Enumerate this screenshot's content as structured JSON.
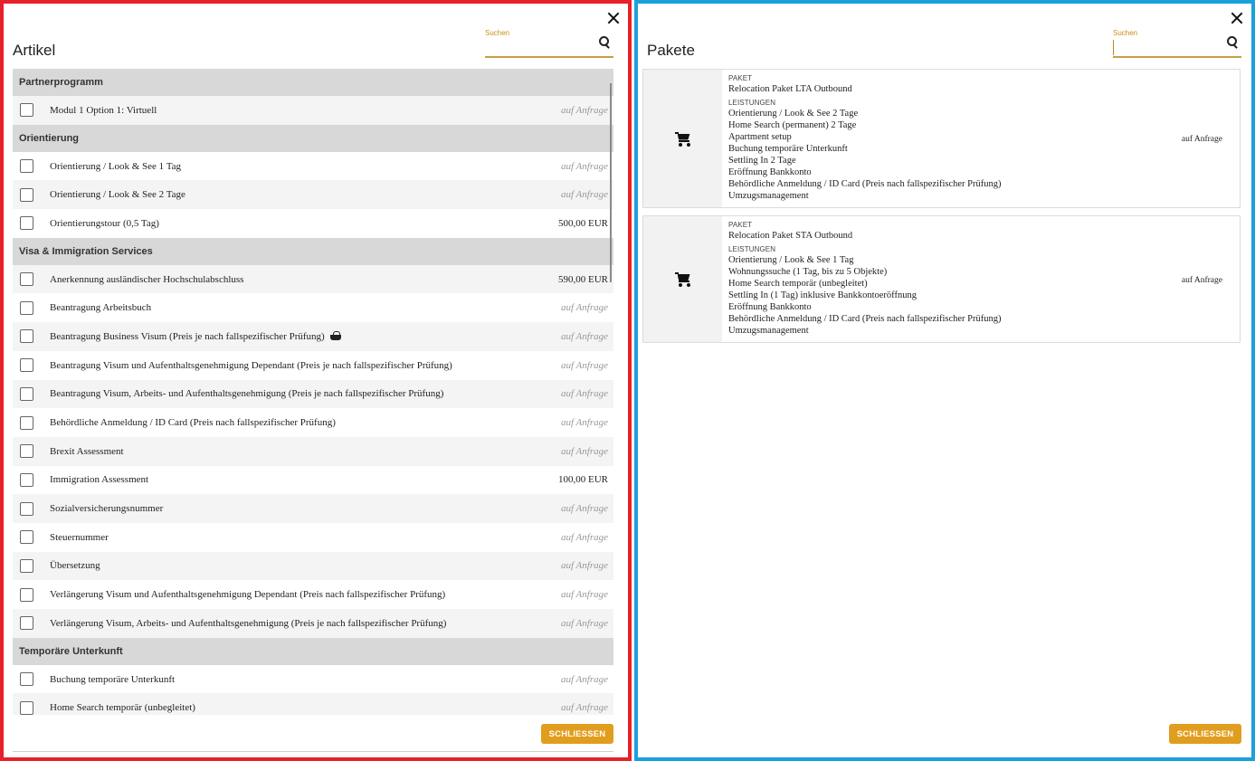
{
  "articles_panel": {
    "title": "Artikel",
    "search": {
      "label": "Suchen",
      "value": ""
    },
    "close_button_label": "SCHLIESSEN",
    "groups": [
      {
        "category": "Partnerprogramm",
        "items": [
          {
            "label": "Modul 1 Option 1: Virtuell",
            "price": "auf Anfrage",
            "basket": false
          }
        ]
      },
      {
        "category": "Orientierung",
        "items": [
          {
            "label": "Orientierung / Look & See 1 Tag",
            "price": "auf Anfrage",
            "basket": false
          },
          {
            "label": "Orientierung / Look & See 2 Tage",
            "price": "auf Anfrage",
            "basket": false
          },
          {
            "label": "Orientierungstour (0,5 Tag)",
            "price": "500,00 EUR",
            "basket": false
          }
        ]
      },
      {
        "category": "Visa & Immigration Services",
        "items": [
          {
            "label": "Anerkennung ausländischer Hochschulabschluss",
            "price": "590,00 EUR",
            "basket": false
          },
          {
            "label": "Beantragung Arbeitsbuch",
            "price": "auf Anfrage",
            "basket": false
          },
          {
            "label": "Beantragung Business Visum (Preis je nach fallspezifischer Prüfung)",
            "price": "auf Anfrage",
            "basket": true
          },
          {
            "label": "Beantragung Visum und Aufenthaltsgenehmigung Dependant (Preis je nach fallspezifischer Prüfung)",
            "price": "auf Anfrage",
            "basket": false
          },
          {
            "label": "Beantragung Visum, Arbeits- und Aufenthaltsgenehmigung (Preis je nach fallspezifischer Prüfung)",
            "price": "auf Anfrage",
            "basket": false
          },
          {
            "label": "Behördliche Anmeldung / ID Card (Preis nach fallspezifischer Prüfung)",
            "price": "auf Anfrage",
            "basket": false
          },
          {
            "label": "Brexit Assessment",
            "price": "auf Anfrage",
            "basket": false
          },
          {
            "label": "Immigration Assessment",
            "price": "100,00 EUR",
            "basket": false
          },
          {
            "label": "Sozialversicherungsnummer",
            "price": "auf Anfrage",
            "basket": false
          },
          {
            "label": "Steuernummer",
            "price": "auf Anfrage",
            "basket": false
          },
          {
            "label": "Übersetzung",
            "price": "auf Anfrage",
            "basket": false
          },
          {
            "label": "Verlängerung Visum und Aufenthaltsgenehmigung Dependant (Preis nach fallspezifischer Prüfung)",
            "price": "auf Anfrage",
            "basket": false
          },
          {
            "label": "Verlängerung Visum, Arbeits- und Aufenthaltsgenehmigung (Preis je nach fallspezifischer Prüfung)",
            "price": "auf Anfrage",
            "basket": false
          }
        ]
      },
      {
        "category": "Temporäre Unterkunft",
        "items": [
          {
            "label": "Buchung temporäre Unterkunft",
            "price": "auf Anfrage",
            "basket": false
          },
          {
            "label": "Home Search temporär (unbegleitet)",
            "price": "auf Anfrage",
            "basket": false
          }
        ]
      }
    ]
  },
  "packages_panel": {
    "title": "Pakete",
    "search": {
      "label": "Suchen",
      "value": ""
    },
    "close_button_label": "SCHLIESSEN",
    "packages": [
      {
        "kicker": "PAKET",
        "name": "Relocation Paket LTA Outbound",
        "services_heading": "LEISTUNGEN",
        "services": [
          "Orientierung / Look & See 2 Tage",
          "Home Search (permanent) 2 Tage",
          "Apartment setup",
          "Buchung temporäre Unterkunft",
          "Settling In 2 Tage",
          "Eröffnung Bankkonto",
          "Behördliche Anmeldung / ID Card (Preis nach fallspezifischer Prüfung)",
          "Umzugsmanagement"
        ],
        "price": "auf Anfrage"
      },
      {
        "kicker": "PAKET",
        "name": "Relocation Paket STA Outbound",
        "services_heading": "LEISTUNGEN",
        "services": [
          "Orientierung / Look & See 1 Tag",
          "Wohnungssuche (1 Tag, bis zu 5 Objekte)",
          "Home Search temporär (unbegleitet)",
          "Settling In (1 Tag) inklusive Bankkontoeröffnung",
          "Eröffnung Bankkonto",
          "Behördliche Anmeldung / ID Card (Preis nach fallspezifischer Prüfung)",
          "Umzugsmanagement"
        ],
        "price": "auf Anfrage"
      }
    ]
  }
}
